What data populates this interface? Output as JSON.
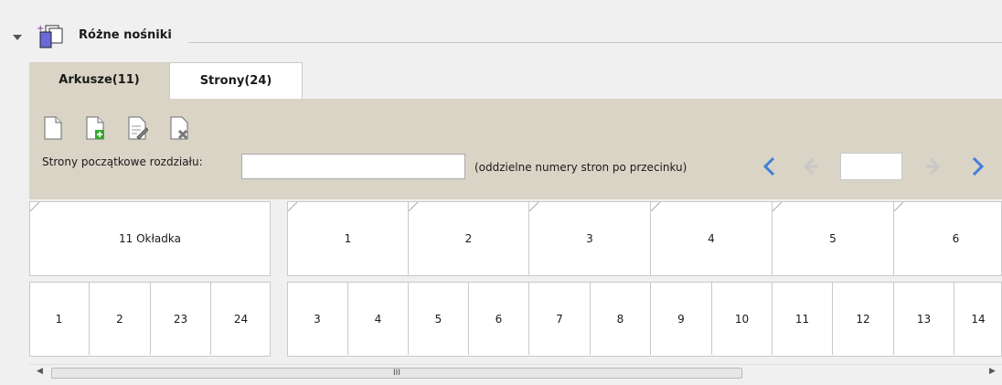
{
  "section": {
    "title": "Różne nośniki"
  },
  "tabs": [
    {
      "label": "Arkusze(11)",
      "active": true
    },
    {
      "label": "Strony(24)",
      "active": false
    }
  ],
  "toolbar": {
    "icons": [
      "new-page-icon",
      "add-page-icon",
      "edit-page-icon",
      "delete-page-icon"
    ],
    "chapter_label": "Strony początkowe rozdziału:",
    "chapter_value": "",
    "chapter_hint": "(oddzielne numery stron po przecinku)",
    "page_value": ""
  },
  "sheets_row": [
    "11 Okładka",
    "1",
    "2",
    "3",
    "4",
    "5",
    "6"
  ],
  "pages_row": [
    "1",
    "2",
    "23",
    "24",
    "3",
    "4",
    "5",
    "6",
    "7",
    "8",
    "9",
    "10",
    "11",
    "12",
    "13",
    "14"
  ],
  "scrollbar": {
    "thumb_label": "III"
  },
  "colors": {
    "panel": "#d9d4c6",
    "nav_active": "#3f7fd8",
    "nav_disabled": "#c8c8c8",
    "add_icon": "#35a82f",
    "delete_icon": "#777777"
  }
}
